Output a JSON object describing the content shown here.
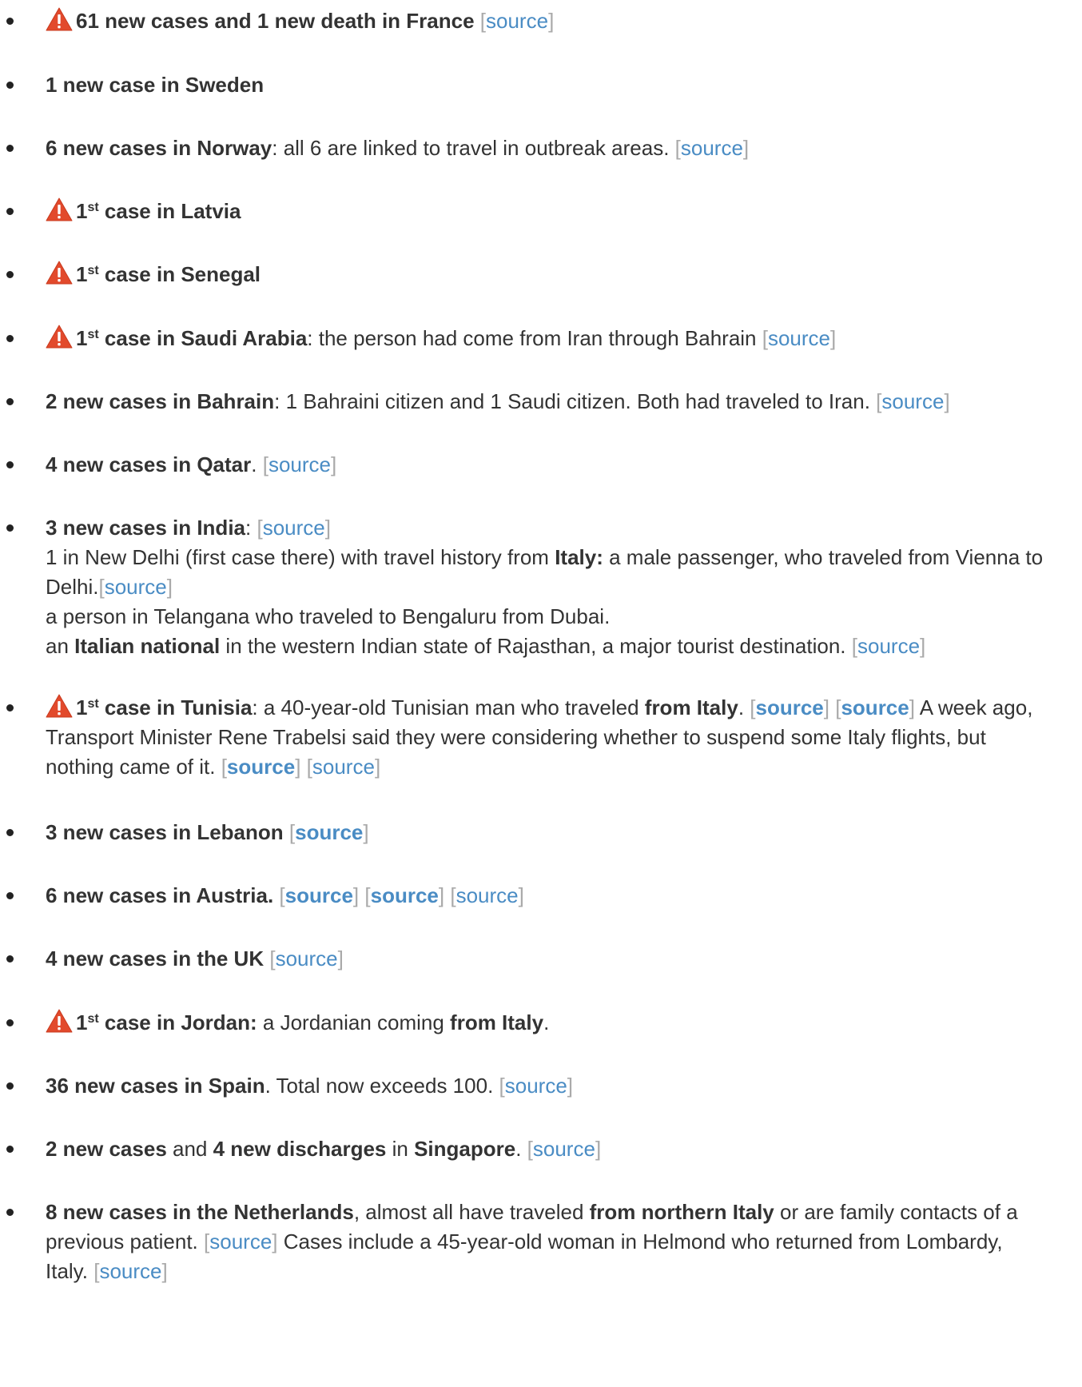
{
  "colors": {
    "text": "#333333",
    "link": "#4a8cc4",
    "bracket": "#aaaaaa",
    "warning": "#e24a2c"
  },
  "icons": {
    "warning": "warning-triangle-icon"
  },
  "source_label": "source",
  "items": [
    {
      "bold": "61 new cases and 1 new death in France",
      "tail": " "
    },
    {
      "bold": "1 new case in Sweden"
    },
    {
      "bold": "6 new cases in Norway",
      "tail": ": all 6 are linked to travel in outbreak areas. "
    },
    {
      "num": "1",
      "sup": "st",
      "bold": " case in Latvia"
    },
    {
      "num": "1",
      "sup": "st",
      "bold": " case in Senegal"
    },
    {
      "num": "1",
      "sup": "st",
      "bold": " case in Saudi Arabia",
      "tail": ": the person had come from Iran through Bahrain "
    },
    {
      "bold": "2 new cases in Bahrain",
      "tail": ": 1 Bahraini citizen and 1 Saudi citizen. Both had traveled to Iran. "
    },
    {
      "bold": "4 new cases in Qatar",
      "tail": ". "
    },
    {
      "bold": "3 new cases in India",
      "tail": ": ",
      "sub": [
        {
          "a": "1 in New Delhi (first case there) with travel history from ",
          "b": "Italy:",
          "c": " a male passenger, who traveled from Vienna to Delhi."
        },
        {
          "a": "a person in Telangana who traveled to Bengaluru from Dubai."
        },
        {
          "a": "an ",
          "b": "Italian national",
          "c": " in the western Indian state of Rajasthan, a major tourist destination. "
        }
      ]
    },
    {
      "num": "1",
      "sup": "st",
      "bold": " case in Tunisia",
      "t1": ": a 40-year-old Tunisian man who traveled ",
      "b2": "from Italy",
      "t2": ". ",
      "t3": " A week ago, Transport Minister Rene Trabelsi said they were considering whether to suspend some Italy flights, but nothing came of it. "
    },
    {
      "bold": "3 new cases in Lebanon",
      "tail": " "
    },
    {
      "bold": "6 new cases in Austria.",
      "tail": " "
    },
    {
      "bold": "4 new cases in the UK",
      "tail": " "
    },
    {
      "num": "1",
      "sup": "st",
      "bold": " case in Jordan:",
      "tail": " a Jordanian coming ",
      "b2": "from Italy",
      "t2": "."
    },
    {
      "bold": "36 new cases in Spain",
      "tail": ". Total now exceeds 100. "
    },
    {
      "b1": "2 new cases",
      "t1": " and ",
      "b2": "4 new discharges",
      "t2": " in ",
      "b3": "Singapore",
      "t3": ". "
    },
    {
      "b1": "8 new cases in the Netherlands",
      "t1": ", almost all have traveled ",
      "b2": "from northern Italy",
      "t2": " or are family contacts of a previous patient. ",
      "t3": " Cases include a 45-year-old woman in Helmond who returned from Lombardy, Italy. "
    }
  ]
}
